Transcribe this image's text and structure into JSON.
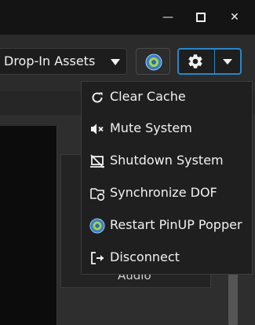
{
  "window": {
    "minimize_glyph": "—",
    "close_glyph": "✕"
  },
  "toolbar": {
    "assets_dropdown": {
      "selected": "Drop-In Assets"
    },
    "popper_button": {
      "icon": "pinup-popper-logo-icon"
    },
    "settings_button": {
      "icon": "gear-icon"
    },
    "settings_menu_button": {
      "icon": "chevron-down-icon"
    }
  },
  "background": {
    "partial_label": "Audio"
  },
  "settings_menu": {
    "items": [
      {
        "label": "Clear Cache",
        "icon": "refresh-icon"
      },
      {
        "label": "Mute System",
        "icon": "mute-icon"
      },
      {
        "label": "Shutdown System",
        "icon": "shutdown-icon"
      },
      {
        "label": "Synchronize DOF",
        "icon": "folder-sync-icon"
      },
      {
        "label": "Restart PinUP Popper",
        "icon": "pinup-popper-logo-icon"
      },
      {
        "label": "Disconnect",
        "icon": "disconnect-icon"
      }
    ]
  },
  "colors": {
    "accent": "#2a86c8",
    "menu_background": "#1f1f1f",
    "titlebar": "#141414"
  }
}
